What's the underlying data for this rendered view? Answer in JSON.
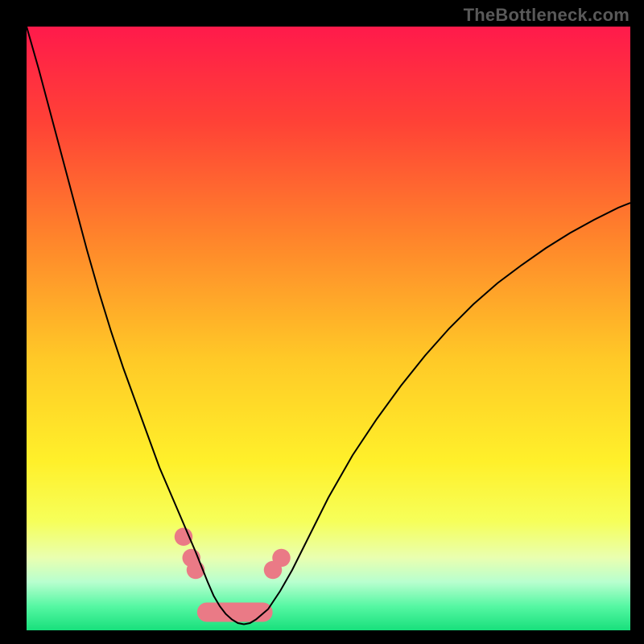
{
  "watermark": "TheBottleneck.com",
  "chart_data": {
    "type": "line",
    "title": "",
    "xlabel": "",
    "ylabel": "",
    "xlim": [
      0,
      100
    ],
    "ylim": [
      0,
      100
    ],
    "grid": false,
    "legend": false,
    "gradient_stops": [
      {
        "pct": 0,
        "color": "#ff1a4b"
      },
      {
        "pct": 16,
        "color": "#ff4236"
      },
      {
        "pct": 35,
        "color": "#ff842b"
      },
      {
        "pct": 55,
        "color": "#ffc927"
      },
      {
        "pct": 72,
        "color": "#fff02a"
      },
      {
        "pct": 82,
        "color": "#f6ff5a"
      },
      {
        "pct": 88,
        "color": "#e9ffb0"
      },
      {
        "pct": 92,
        "color": "#b8ffcf"
      },
      {
        "pct": 96,
        "color": "#56f7a3"
      },
      {
        "pct": 100,
        "color": "#18e07c"
      }
    ],
    "series": [
      {
        "name": "main-curve",
        "color": "#000000",
        "stroke_width": 2,
        "x": [
          0,
          2,
          4,
          6,
          8,
          10,
          12,
          14,
          16,
          18,
          20,
          22,
          23.5,
          25,
          26.5,
          28,
          29,
          30,
          31,
          32,
          33,
          34,
          35,
          36,
          37,
          38,
          40,
          42,
          44,
          46,
          48,
          50,
          54,
          58,
          62,
          66,
          70,
          74,
          78,
          82,
          86,
          90,
          94,
          98,
          100
        ],
        "y": [
          100,
          93,
          85.5,
          78,
          70.5,
          63,
          56,
          49.5,
          43.5,
          38,
          32.5,
          27,
          23.5,
          20,
          16.5,
          13,
          10.5,
          8,
          5.7,
          4,
          2.7,
          1.8,
          1.2,
          1.0,
          1.2,
          1.8,
          3.5,
          6.5,
          10,
          14,
          18,
          22,
          29,
          35,
          40.5,
          45.5,
          50,
          54,
          57.5,
          60.5,
          63.3,
          65.8,
          68,
          70,
          70.8
        ]
      }
    ],
    "markers": [
      {
        "name": "pink-dot",
        "shape": "circle",
        "x": 26.0,
        "y": 15.5,
        "r": 1.5,
        "color": "#ea7a86"
      },
      {
        "name": "pink-dot",
        "shape": "circle",
        "x": 27.3,
        "y": 12.0,
        "r": 1.5,
        "color": "#ea7a86"
      },
      {
        "name": "pink-dot",
        "shape": "circle",
        "x": 28.0,
        "y": 10.0,
        "r": 1.5,
        "color": "#ea7a86"
      },
      {
        "name": "pink-dot",
        "shape": "circle",
        "x": 40.8,
        "y": 10.0,
        "r": 1.5,
        "color": "#ea7a86"
      },
      {
        "name": "pink-dot",
        "shape": "circle",
        "x": 42.2,
        "y": 12.0,
        "r": 1.5,
        "color": "#ea7a86"
      },
      {
        "name": "pink-bar",
        "shape": "roundrect",
        "x": 34.5,
        "y": 3.0,
        "w": 12.5,
        "h": 3.2,
        "r": 1.6,
        "color": "#ea7a86"
      }
    ]
  }
}
